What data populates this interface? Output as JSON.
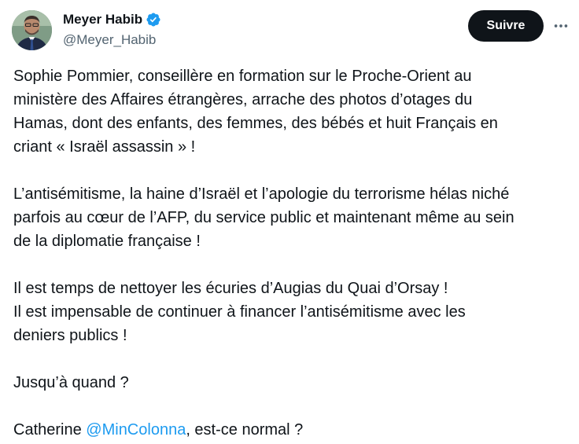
{
  "author": {
    "display_name": "Meyer Habib",
    "handle": "@Meyer_Habib",
    "verified": true,
    "verified_color": "#1d9bf0",
    "avatar_icon": "profile-photo"
  },
  "actions": {
    "follow_label": "Suivre",
    "more_icon": "more-horizontal-icon"
  },
  "tweet": {
    "paragraphs": [
      {
        "lines": [
          "Sophie Pommier, conseillère en formation sur le Proche-Orient au",
          "ministère des Affaires étrangères, arrache des photos d’otages du",
          "Hamas, dont des enfants, des femmes, des bébés et huit Français en",
          "criant « Israël assassin » !"
        ]
      },
      {
        "lines": [
          "L’antisémitisme, la haine d’Israël et l’apologie du terrorisme hélas niché",
          "parfois au cœur de l’AFP, du service public et maintenant même au sein",
          "de la diplomatie française !"
        ]
      },
      {
        "lines": [
          "Il est temps de nettoyer les écuries d’Augias du Quai d’Orsay !",
          "Il est impensable de continuer à financer l’antisémitisme avec les",
          "deniers publics !"
        ]
      },
      {
        "lines": [
          "Jusqu’à quand ?"
        ]
      },
      {
        "prefix": "Catherine ",
        "mention": "@MinColonna",
        "suffix": ", est-ce normal ?"
      }
    ]
  },
  "colors": {
    "text": "#0f1419",
    "secondary": "#536471",
    "link": "#1d9bf0",
    "follow_bg": "#0f1419"
  }
}
